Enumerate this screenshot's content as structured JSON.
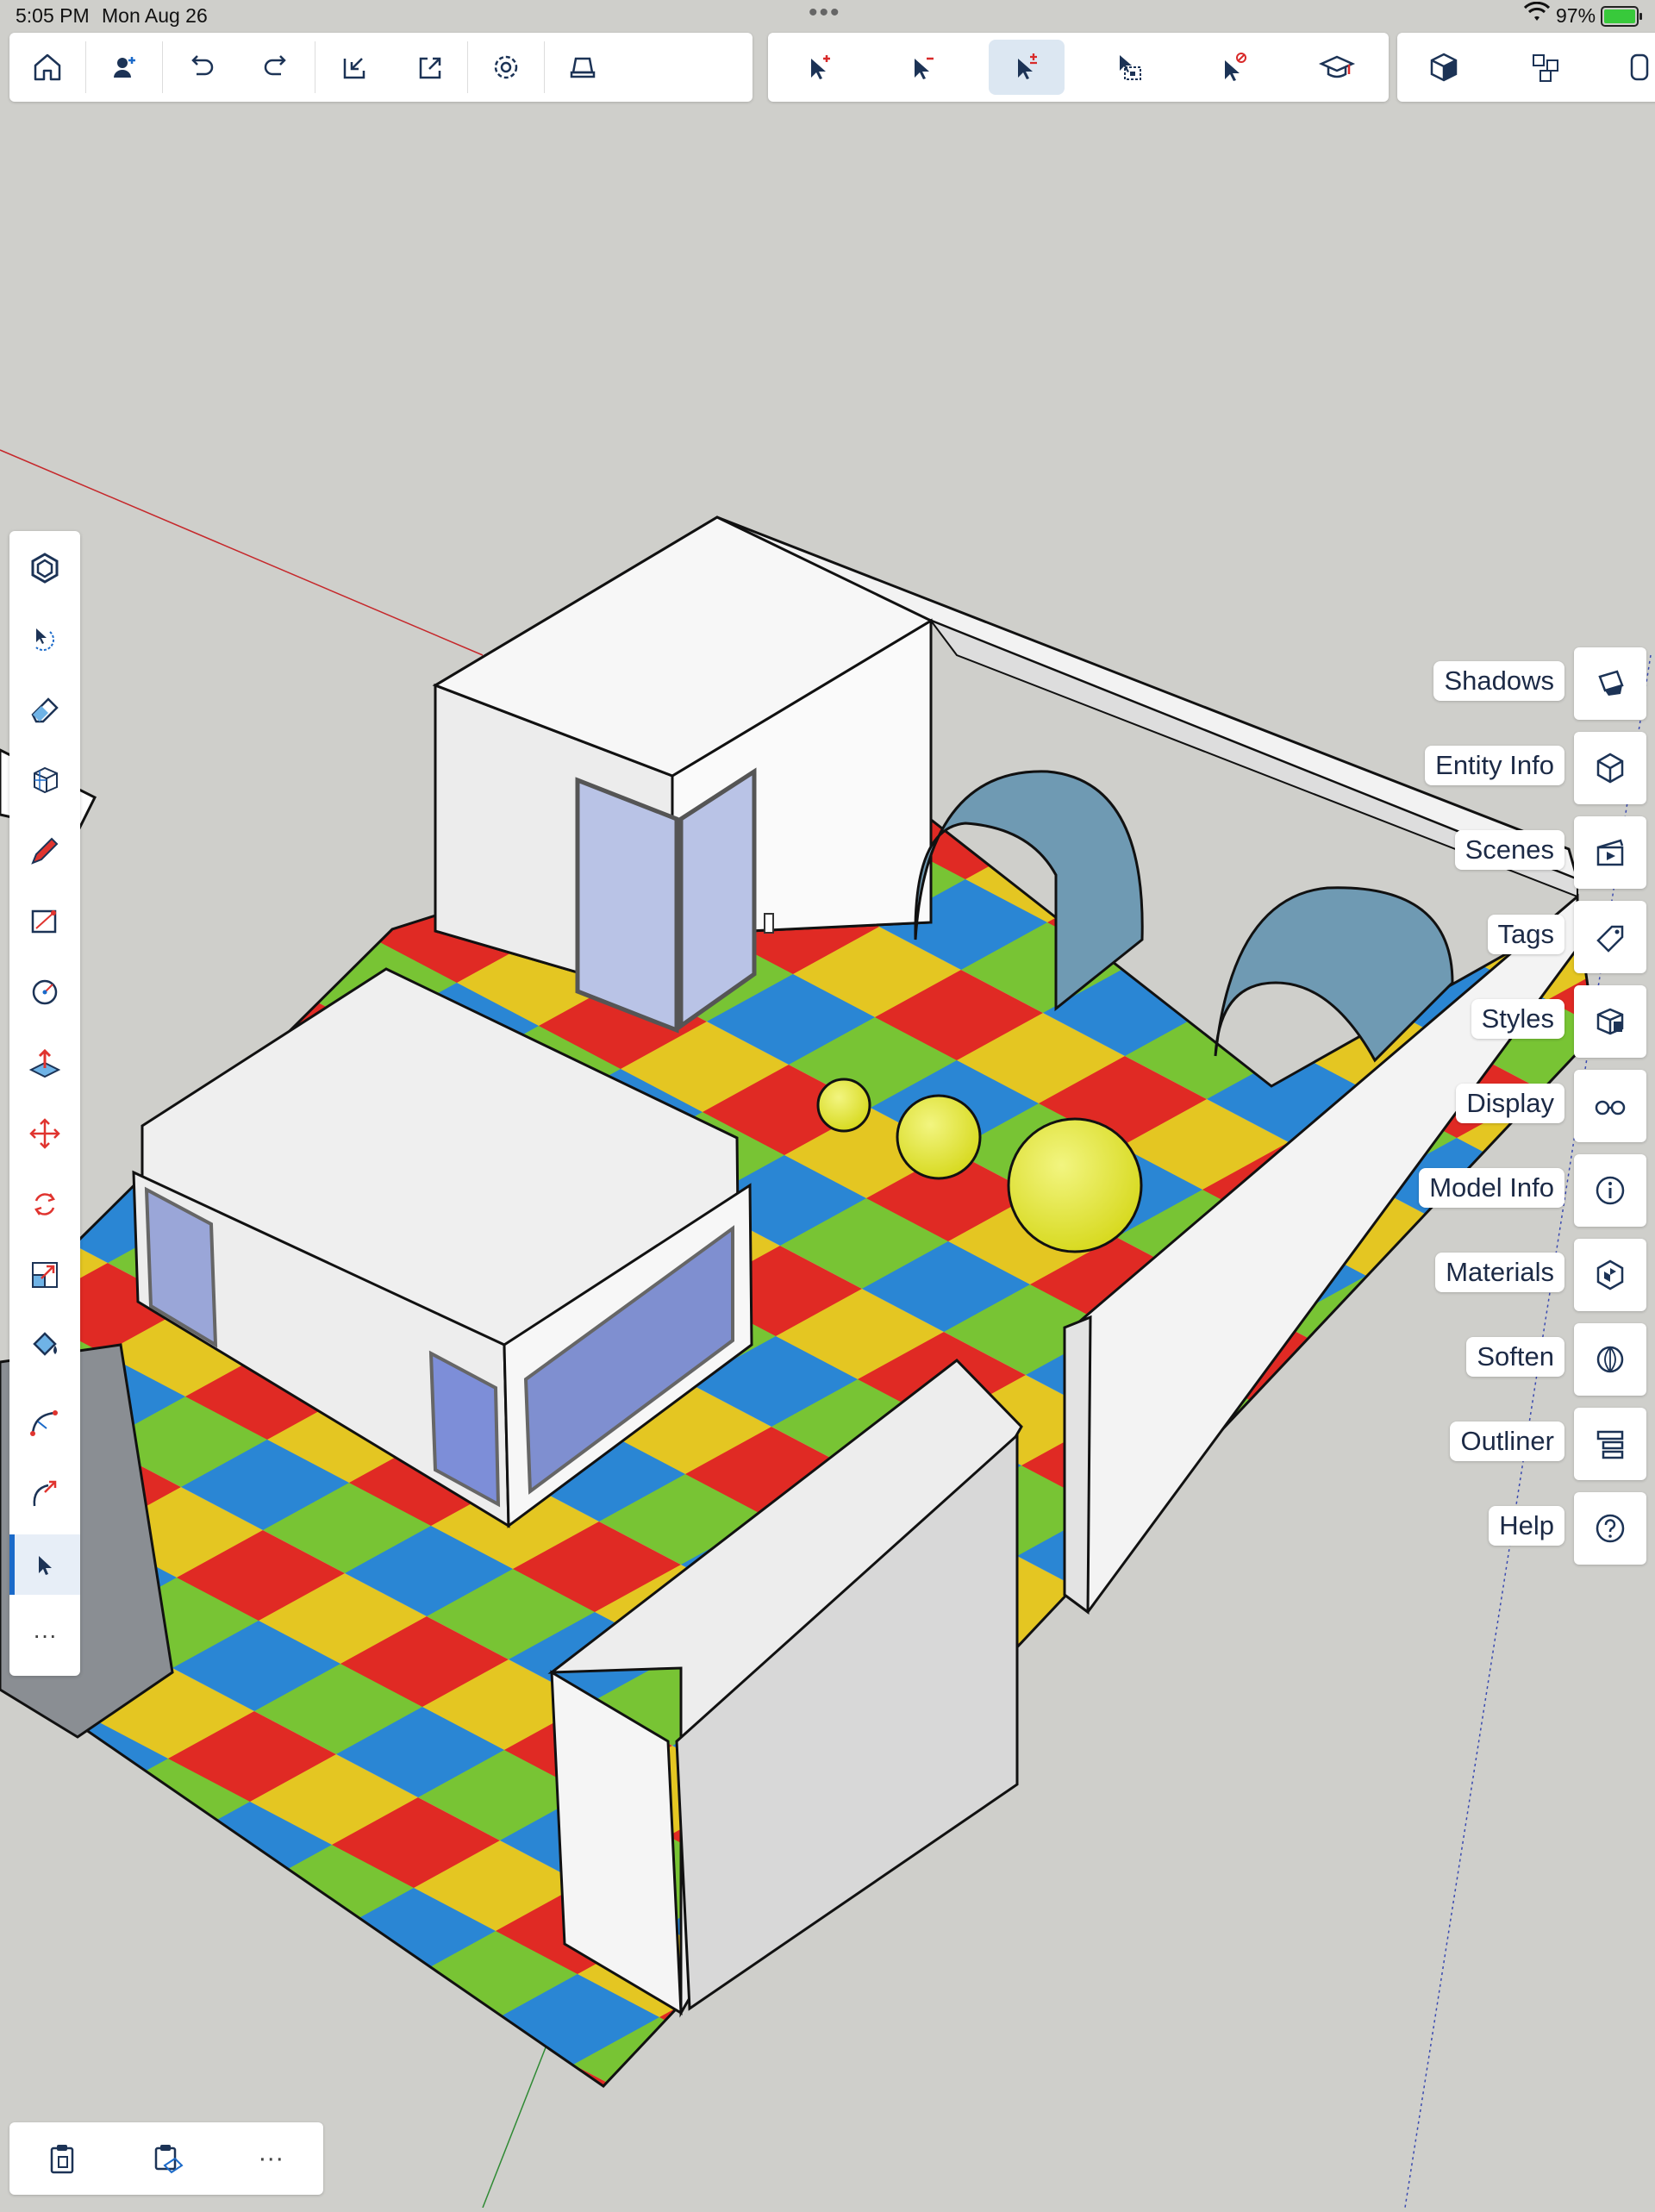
{
  "status": {
    "time": "5:05 PM",
    "date": "Mon Aug 26",
    "battery": "97%"
  },
  "toolbar": {
    "left": [
      {
        "name": "home-icon"
      },
      {
        "name": "add-user-icon"
      },
      {
        "name": "undo-icon"
      },
      {
        "name": "redo-icon"
      },
      {
        "name": "import-icon"
      },
      {
        "name": "export-icon"
      },
      {
        "name": "settings-icon"
      },
      {
        "name": "print-icon"
      }
    ],
    "select": [
      {
        "name": "select-add-icon"
      },
      {
        "name": "select-subtract-icon"
      },
      {
        "name": "select-toggle-icon",
        "active": true
      },
      {
        "name": "select-inside-icon"
      },
      {
        "name": "select-exclude-icon"
      },
      {
        "name": "instructor-icon"
      }
    ],
    "view": [
      {
        "name": "iso-view-icon"
      },
      {
        "name": "components-icon"
      },
      {
        "name": "layers-icon"
      }
    ]
  },
  "left_tools": [
    {
      "name": "sketchup-logo-icon"
    },
    {
      "name": "orbit-icon"
    },
    {
      "name": "eraser-icon"
    },
    {
      "name": "box-icon"
    },
    {
      "name": "pencil-icon"
    },
    {
      "name": "rectangle-icon"
    },
    {
      "name": "circle-icon"
    },
    {
      "name": "push-pull-icon"
    },
    {
      "name": "move-icon"
    },
    {
      "name": "rotate-icon"
    },
    {
      "name": "scale-icon"
    },
    {
      "name": "paint-bucket-icon"
    },
    {
      "name": "arc-icon"
    },
    {
      "name": "follow-me-icon"
    },
    {
      "name": "select-icon",
      "active": true
    }
  ],
  "left_more": "···",
  "right_panels": [
    {
      "label": "Shadows",
      "icon": "shadows-icon"
    },
    {
      "label": "Entity Info",
      "icon": "entity-info-icon"
    },
    {
      "label": "Scenes",
      "icon": "scenes-icon"
    },
    {
      "label": "Tags",
      "icon": "tags-icon"
    },
    {
      "label": "Styles",
      "icon": "styles-icon"
    },
    {
      "label": "Display",
      "icon": "display-icon"
    },
    {
      "label": "Model Info",
      "icon": "model-info-icon"
    },
    {
      "label": "Materials",
      "icon": "materials-icon"
    },
    {
      "label": "Soften",
      "icon": "soften-icon"
    },
    {
      "label": "Outliner",
      "icon": "outliner-icon"
    },
    {
      "label": "Help",
      "icon": "help-icon"
    }
  ],
  "bottom": {
    "more": "···"
  },
  "colors": {
    "accent": "#1b6ac9",
    "icon": "#1c3356",
    "red_axis": "#c6282b",
    "green_axis": "#2f8a34"
  }
}
